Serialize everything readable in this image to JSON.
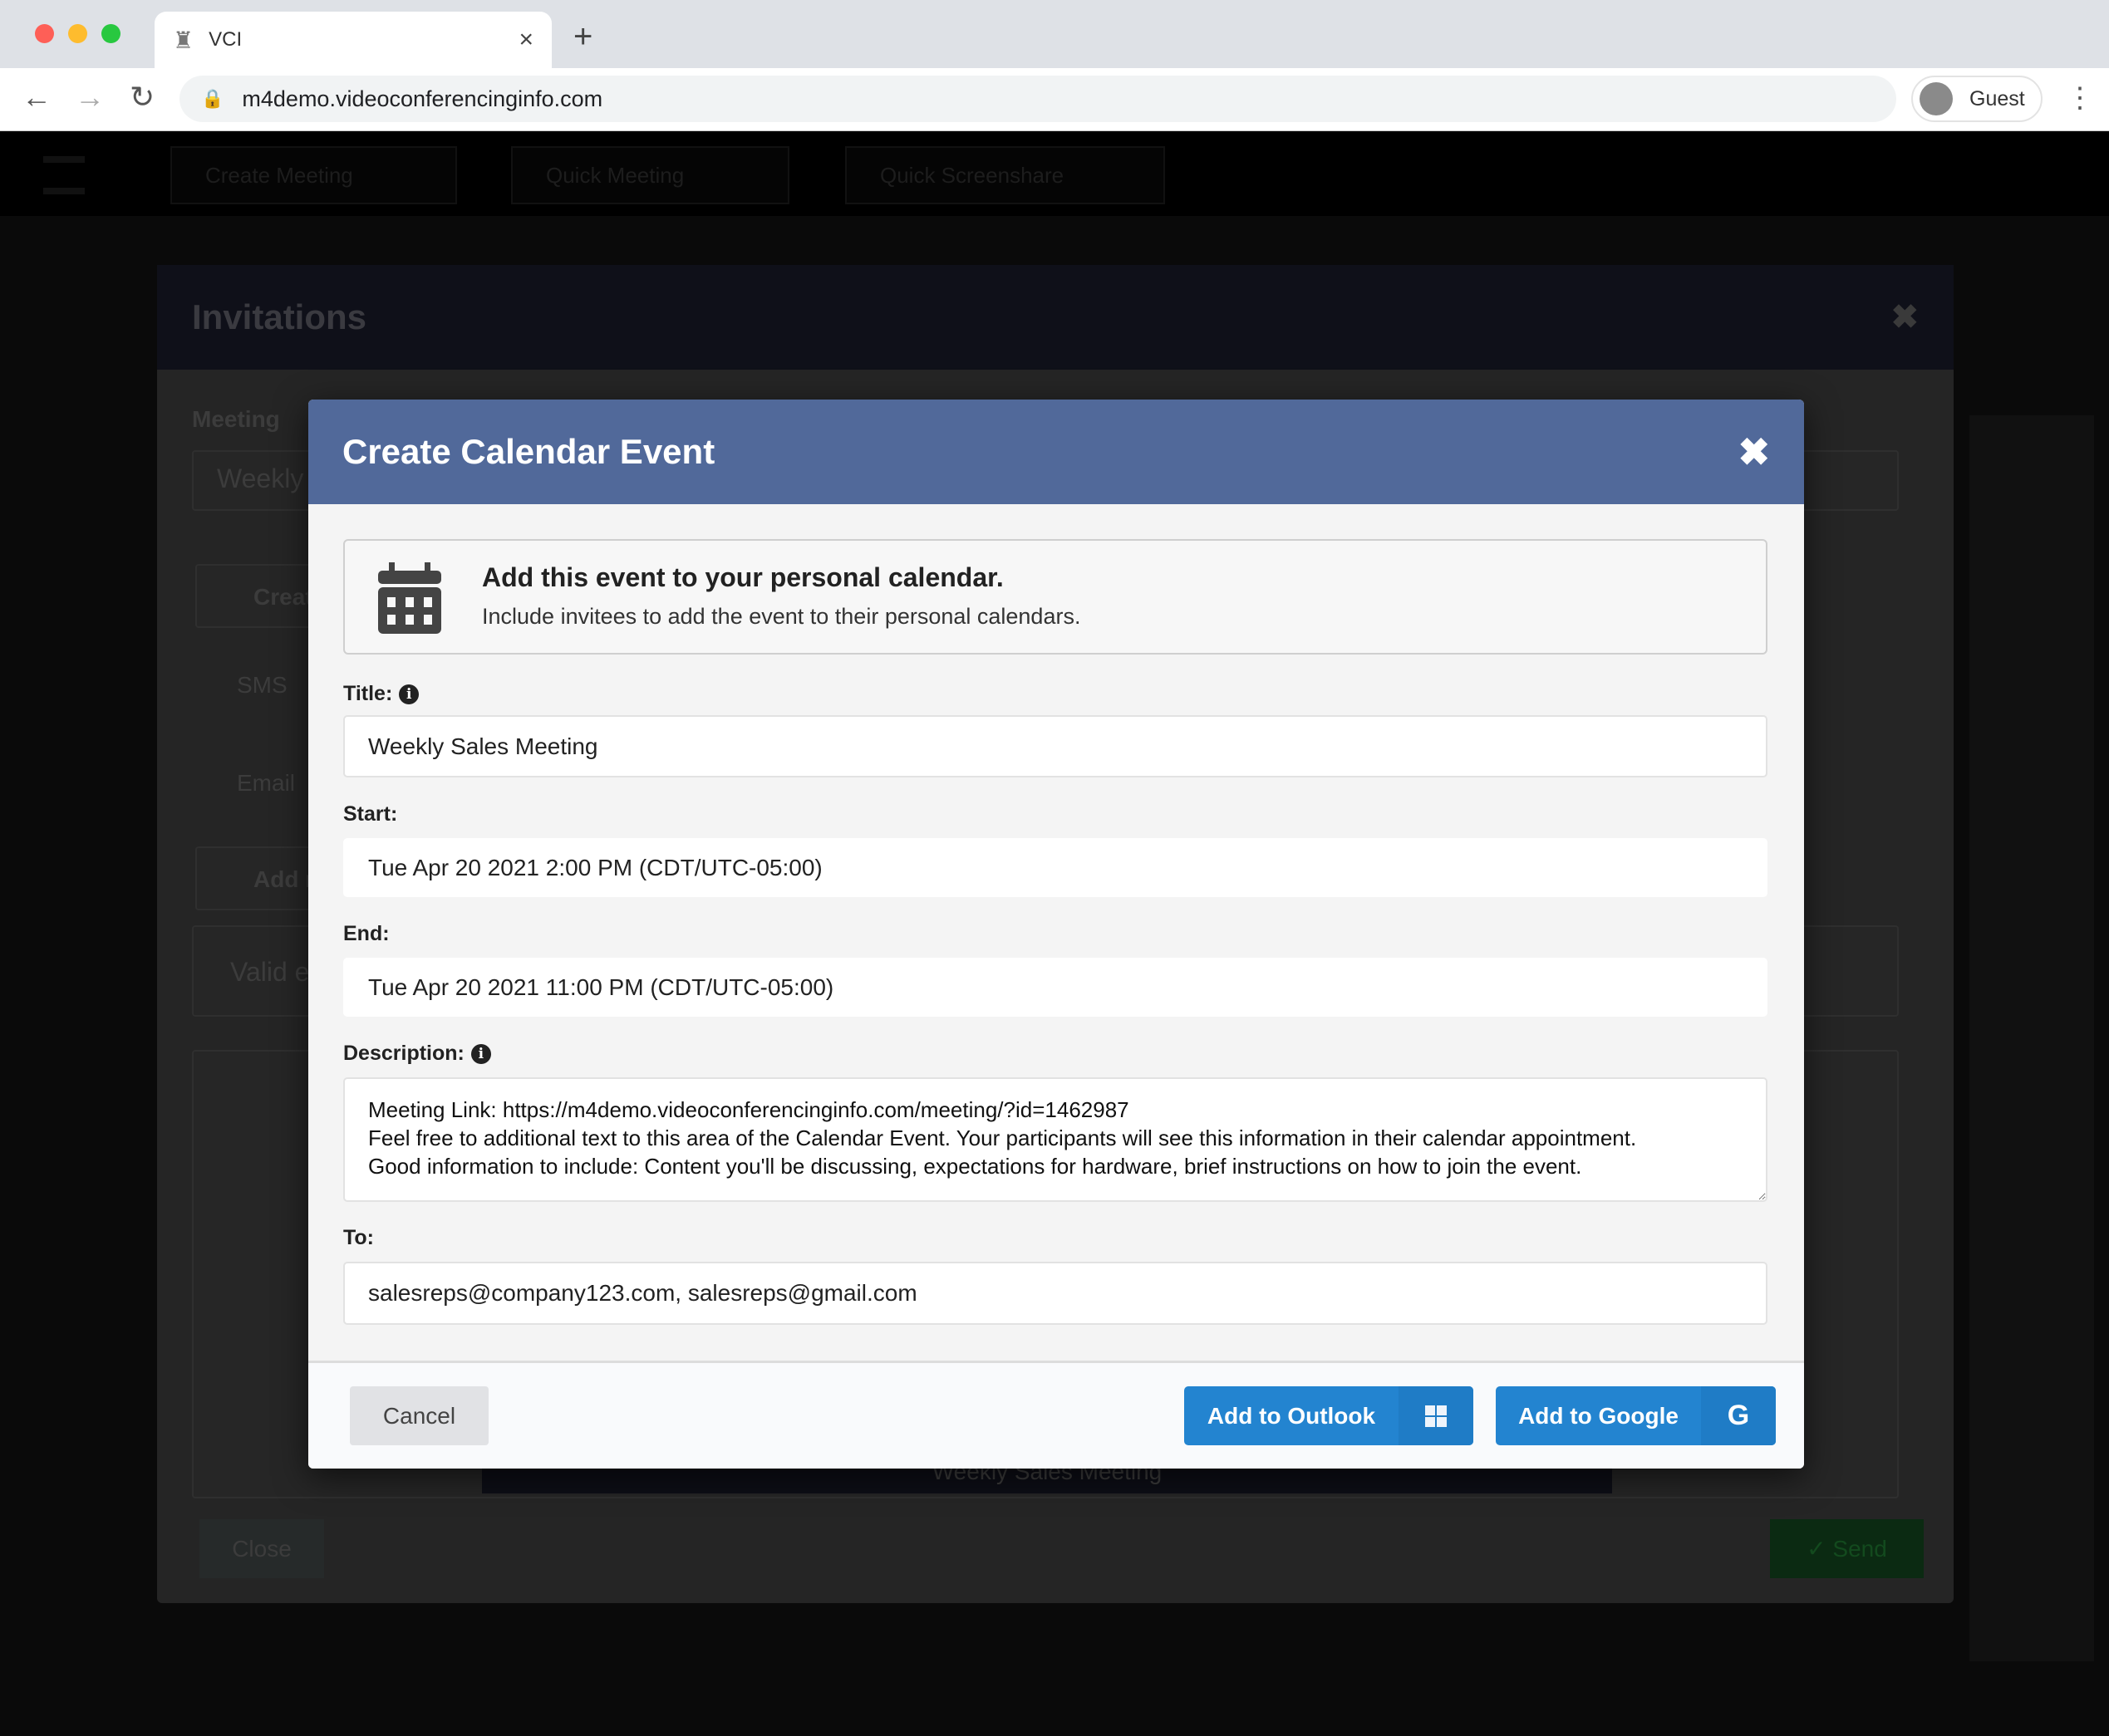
{
  "browser": {
    "tab_title": "VCI",
    "url": "m4demo.videoconferencinginfo.com",
    "profile": "Guest"
  },
  "appbar": {
    "buttons": [
      "Create Meeting",
      "Quick Meeting",
      "Quick Screenshare"
    ]
  },
  "background_modal": {
    "title": "Invitations",
    "meeting_label": "Meeting",
    "meeting_value": "Weekly",
    "create_button": "Creat",
    "sms_label": "SMS",
    "email_label": "Email",
    "add_button": "Add r",
    "email_placeholder": "Valid e",
    "preview_title": "Weekly Sales Meeting",
    "close_button": "Close",
    "send_button": "Send"
  },
  "dialog": {
    "title": "Create Calendar Event",
    "info_heading": "Add this event to your personal calendar.",
    "info_text": "Include invitees to add the event to their personal calendars.",
    "title_label": "Title:",
    "title_value": "Weekly Sales Meeting",
    "start_label": "Start:",
    "start_value": "Tue Apr 20 2021 2:00 PM (CDT/UTC-05:00)",
    "end_label": "End:",
    "end_value": "Tue Apr 20 2021 11:00 PM (CDT/UTC-05:00)",
    "description_label": "Description:",
    "description_lines": [
      "Meeting Link: https://m4demo.videoconferencinginfo.com/meeting/?id=1462987",
      "Feel free to additional text to this area of the Calendar Event. Your participants will see this information in their calendar appointment.",
      "Good information to include: Content you'll be discussing, expectations for hardware, brief instructions on how to join the event."
    ],
    "to_label": "To:",
    "to_value": "salesreps@company123.com, salesreps@gmail.com",
    "cancel": "Cancel",
    "outlook": "Add to Outlook",
    "google": "Add to Google"
  },
  "colors": {
    "header": "#51699a",
    "primary": "#2384d0"
  }
}
